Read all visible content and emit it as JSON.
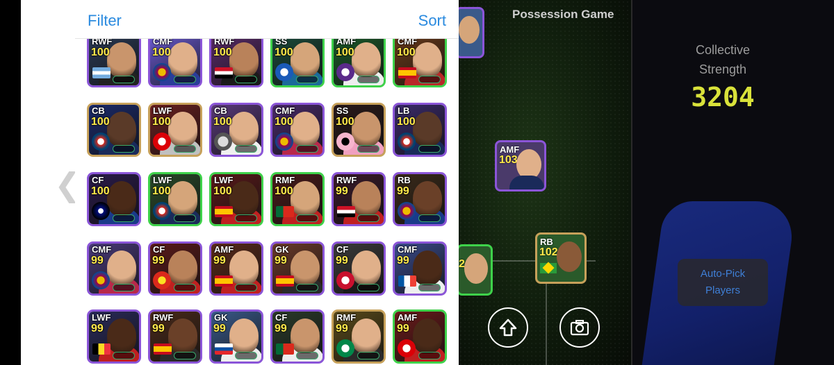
{
  "header": {
    "filter_label": "Filter",
    "sort_label": "Sort"
  },
  "nav": {
    "back_icon": "chevron-left-icon"
  },
  "pitch": {
    "title": "Possession Game",
    "cards": [
      {
        "position": "",
        "rating": ""
      },
      {
        "position": "AMF",
        "rating": "103"
      },
      {
        "position": "RB",
        "rating": "102"
      },
      {
        "position": "",
        "rating": "2"
      }
    ]
  },
  "team": {
    "collective_label_1": "Collective",
    "collective_label_2": "Strength",
    "collective_value": "3204",
    "auto_pick_1": "Auto-Pick",
    "auto_pick_2": "Players"
  },
  "controls": {
    "upload_icon": "arrow-up-icon",
    "camera_icon": "camera-icon"
  },
  "players": [
    {
      "position": "RWF",
      "rating": "100",
      "flag": "argentina",
      "border": "purple",
      "bg": "#2b3a55",
      "skin": "#c9956c",
      "shirt": "#222"
    },
    {
      "position": "CMF",
      "rating": "100",
      "flag": "barca",
      "border": "purple",
      "bg": "#6a5ad0",
      "skin": "#e0b08a",
      "shirt": "#2a3c9a"
    },
    {
      "position": "RWF",
      "rating": "100",
      "flag": "egypt",
      "border": "purple",
      "bg": "#5a2b6a",
      "skin": "#b9825a",
      "shirt": "#1a1a1a"
    },
    {
      "position": "SS",
      "rating": "100",
      "flag": "club-blue",
      "border": "green",
      "bg": "#1a4a3a",
      "skin": "#d5a57a",
      "shirt": "#1a6a9a"
    },
    {
      "position": "AMF",
      "rating": "100",
      "flag": "club-purple",
      "border": "green",
      "bg": "#1b5a2a",
      "skin": "#e0b08a",
      "shirt": "#eee"
    },
    {
      "position": "CMF",
      "rating": "100",
      "flag": "spain",
      "border": "green",
      "bg": "#6a3a1a",
      "skin": "#e0b08a",
      "shirt": "#b82828"
    },
    {
      "position": "CB",
      "rating": "100",
      "flag": "psg",
      "border": "gold",
      "bg": "#1a2a6a",
      "skin": "#5a3a28",
      "shirt": "#1a2a5a"
    },
    {
      "position": "LWF",
      "rating": "100",
      "flag": "arsenal",
      "border": "gold",
      "bg": "#6a2020",
      "skin": "#e0b08a",
      "shirt": "#c0c0c0"
    },
    {
      "position": "CB",
      "rating": "100",
      "flag": "club-white",
      "border": "purple",
      "bg": "#5a3a7a",
      "skin": "#e0b08a",
      "shirt": "#f0f0f0"
    },
    {
      "position": "CMF",
      "rating": "100",
      "flag": "barca",
      "border": "purple",
      "bg": "#4a2a6a",
      "skin": "#e0b08a",
      "shirt": "#b8284a"
    },
    {
      "position": "SS",
      "rating": "100",
      "flag": "club-miami",
      "border": "gold",
      "bg": "#2a1a1a",
      "skin": "#c9956c",
      "shirt": "#f0a0c0"
    },
    {
      "position": "LB",
      "rating": "100",
      "flag": "psg",
      "border": "purple",
      "bg": "#3a2a6a",
      "skin": "#5a3a28",
      "shirt": "#1a2a5a"
    },
    {
      "position": "CF",
      "rating": "100",
      "flag": "inter",
      "border": "purple",
      "bg": "#2a1a4a",
      "skin": "#4a2a18",
      "shirt": "#1a3a8a"
    },
    {
      "position": "LWF",
      "rating": "100",
      "flag": "psg",
      "border": "green",
      "bg": "#2a4a2a",
      "skin": "#d5a57a",
      "shirt": "#1a2a5a"
    },
    {
      "position": "LWF",
      "rating": "100",
      "flag": "spain",
      "border": "green",
      "bg": "#5a1a1a",
      "skin": "#4a2a18",
      "shirt": "#c02020"
    },
    {
      "position": "RMF",
      "rating": "100",
      "flag": "portugal",
      "border": "green",
      "bg": "#4a1a1a",
      "skin": "#d5a57a",
      "shirt": "#c02020"
    },
    {
      "position": "RWF",
      "rating": "99",
      "flag": "egypt",
      "border": "purple",
      "bg": "#3a1a2a",
      "skin": "#b9825a",
      "shirt": "#c02020"
    },
    {
      "position": "RB",
      "rating": "99",
      "flag": "barca",
      "border": "purple",
      "bg": "#3a2a1a",
      "skin": "#6a4028",
      "shirt": "#1a3a8a"
    },
    {
      "position": "CMF",
      "rating": "99",
      "flag": "barca",
      "border": "purple",
      "bg": "#4a3a7a",
      "skin": "#e0b08a",
      "shirt": "#b8284a"
    },
    {
      "position": "CF",
      "rating": "99",
      "flag": "manutd",
      "border": "purple",
      "bg": "#5a1a1a",
      "skin": "#b9825a",
      "shirt": "#c02020"
    },
    {
      "position": "AMF",
      "rating": "99",
      "flag": "spain",
      "border": "purple",
      "bg": "#5a2a1a",
      "skin": "#e0b08a",
      "shirt": "#c02020"
    },
    {
      "position": "GK",
      "rating": "99",
      "flag": "spain",
      "border": "purple",
      "bg": "#6a3a2a",
      "skin": "#c9956c",
      "shirt": "#2a2a2a"
    },
    {
      "position": "CF",
      "rating": "99",
      "flag": "club-red",
      "border": "purple",
      "bg": "#3a3a3a",
      "skin": "#e0b08a",
      "shirt": "#1a1a1a"
    },
    {
      "position": "CMF",
      "rating": "99",
      "flag": "france",
      "border": "purple",
      "bg": "#3a4a8a",
      "skin": "#4a2a18",
      "shirt": "#eee"
    },
    {
      "position": "LWF",
      "rating": "99",
      "flag": "belgium",
      "border": "purple",
      "bg": "#2a2a5a",
      "skin": "#4a2a18",
      "shirt": "#c02020"
    },
    {
      "position": "RWF",
      "rating": "99",
      "flag": "spain",
      "border": "purple",
      "bg": "#4a2a1a",
      "skin": "#6a4028",
      "shirt": "#2a2a2a"
    },
    {
      "position": "GK",
      "rating": "99",
      "flag": "slovenia",
      "border": "purple",
      "bg": "#3a5a8a",
      "skin": "#e0b08a",
      "shirt": "#eee"
    },
    {
      "position": "CF",
      "rating": "99",
      "flag": "portugal",
      "border": "purple",
      "bg": "#2a3a2a",
      "skin": "#c9956c",
      "shirt": "#eee"
    },
    {
      "position": "RMF",
      "rating": "99",
      "flag": "celtic",
      "border": "gold",
      "bg": "#5a4a1a",
      "skin": "#e0b08a",
      "shirt": "#2a2a2a"
    },
    {
      "position": "AMF",
      "rating": "99",
      "flag": "arsenal",
      "border": "green",
      "bg": "#6a1a1a",
      "skin": "#4a2a18",
      "shirt": "#c02020"
    }
  ]
}
